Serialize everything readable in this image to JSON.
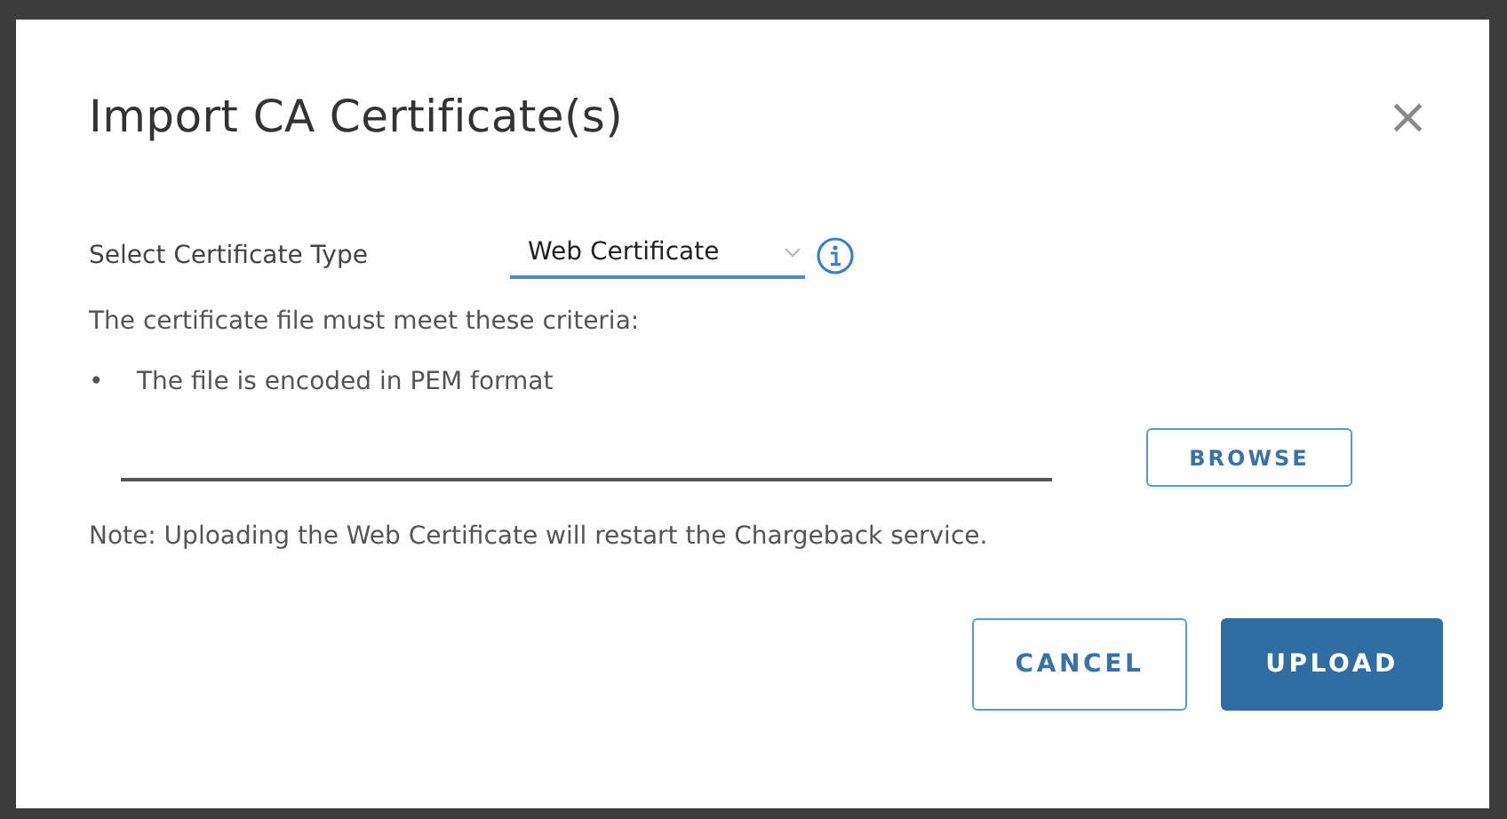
{
  "dialog": {
    "title": "Import CA Certificate(s)",
    "close": "×"
  },
  "certificate_type": {
    "label": "Select Certificate Type",
    "value": "Web Certificate"
  },
  "criteria_intro": "The certificate file must meet these criteria:",
  "criteria": [
    {
      "bullet": "•",
      "text": "The file is encoded in PEM format"
    }
  ],
  "browse_button": "BROWSE",
  "note": "Note: Uploading the Web Certificate will restart the Chargeback service.",
  "buttons": [
    {
      "label": "CANCEL",
      "kind": "secondary"
    },
    {
      "label": "UPLOAD",
      "kind": "primary"
    }
  ]
}
